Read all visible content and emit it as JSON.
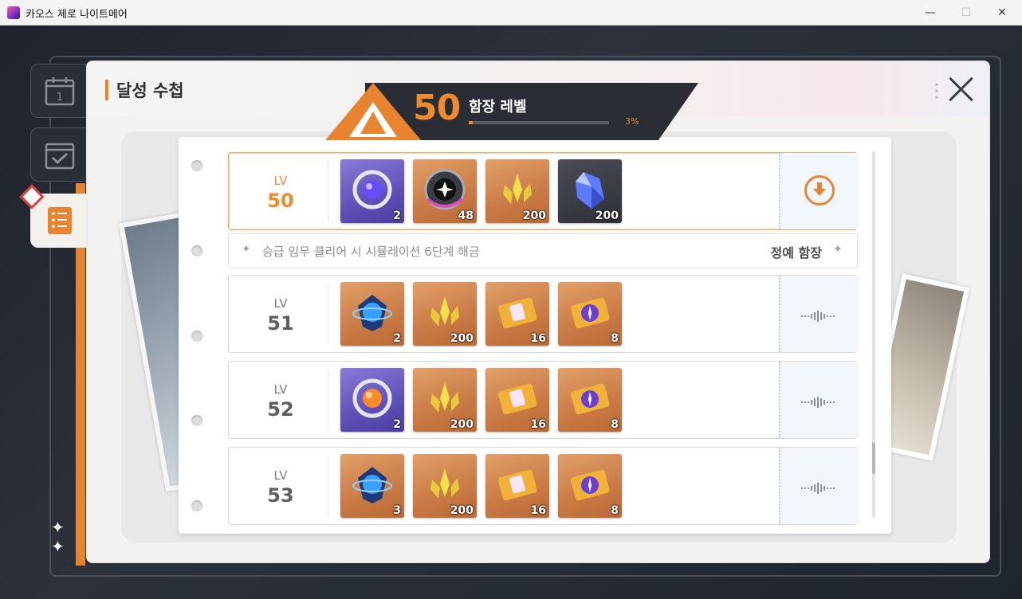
{
  "window": {
    "title": "카오스 제로 나이트메어",
    "controls": [
      "—",
      "☐",
      "✕"
    ]
  },
  "side_tabs": [
    {
      "icon": "calendar-icon",
      "label": "1"
    },
    {
      "icon": "checklist-icon"
    },
    {
      "icon": "notebook-icon",
      "active": true
    }
  ],
  "panel": {
    "title": "달성 수첩"
  },
  "banner": {
    "level": "50",
    "label": "함장 레벨",
    "progress_text": "3%",
    "progress": 0.03
  },
  "rows": [
    {
      "lv_label": "LV",
      "level": "50",
      "current": true,
      "action": "claim",
      "items": [
        {
          "icon": "silver-ring-orb-icon",
          "color": "purple",
          "count": "2"
        },
        {
          "icon": "dark-star-gear-icon",
          "color": "orange",
          "count": "48"
        },
        {
          "icon": "gold-leaf-crystal-icon",
          "color": "orange",
          "count": "200"
        },
        {
          "icon": "blue-crystal-icon",
          "color": "dark",
          "count": "200"
        }
      ]
    },
    {
      "lv_label": "LV",
      "level": "51",
      "action": "locked",
      "items": [
        {
          "icon": "blue-orb-shield-icon",
          "color": "orange",
          "count": "2"
        },
        {
          "icon": "gold-leaf-crystal-icon",
          "color": "orange",
          "count": "200"
        },
        {
          "icon": "gold-ticket-icon",
          "color": "orange",
          "count": "16"
        },
        {
          "icon": "gold-compass-ticket-icon",
          "color": "orange",
          "count": "8"
        }
      ]
    },
    {
      "lv_label": "LV",
      "level": "52",
      "action": "locked",
      "items": [
        {
          "icon": "orange-ring-orb-icon",
          "color": "purple",
          "count": "2"
        },
        {
          "icon": "gold-leaf-crystal-icon",
          "color": "orange",
          "count": "200"
        },
        {
          "icon": "gold-ticket-icon",
          "color": "orange",
          "count": "16"
        },
        {
          "icon": "gold-compass-ticket-icon",
          "color": "orange",
          "count": "8"
        }
      ]
    },
    {
      "lv_label": "LV",
      "level": "53",
      "action": "locked",
      "items": [
        {
          "icon": "blue-orb-shield-icon",
          "color": "orange",
          "count": "3"
        },
        {
          "icon": "gold-leaf-crystal-icon",
          "color": "orange",
          "count": "200"
        },
        {
          "icon": "gold-ticket-icon",
          "color": "orange",
          "count": "16"
        },
        {
          "icon": "gold-compass-ticket-icon",
          "color": "orange",
          "count": "8"
        }
      ]
    }
  ],
  "info_row": {
    "text": "승급 임무 클리어 시 시뮬레이션 6단계 해금",
    "right_label": "정예 함장"
  },
  "colors": {
    "accent": "#e8832f",
    "banner_dark": "#2a2d33",
    "tile_orange": "#c97a45",
    "tile_purple": "#5e50b6"
  }
}
